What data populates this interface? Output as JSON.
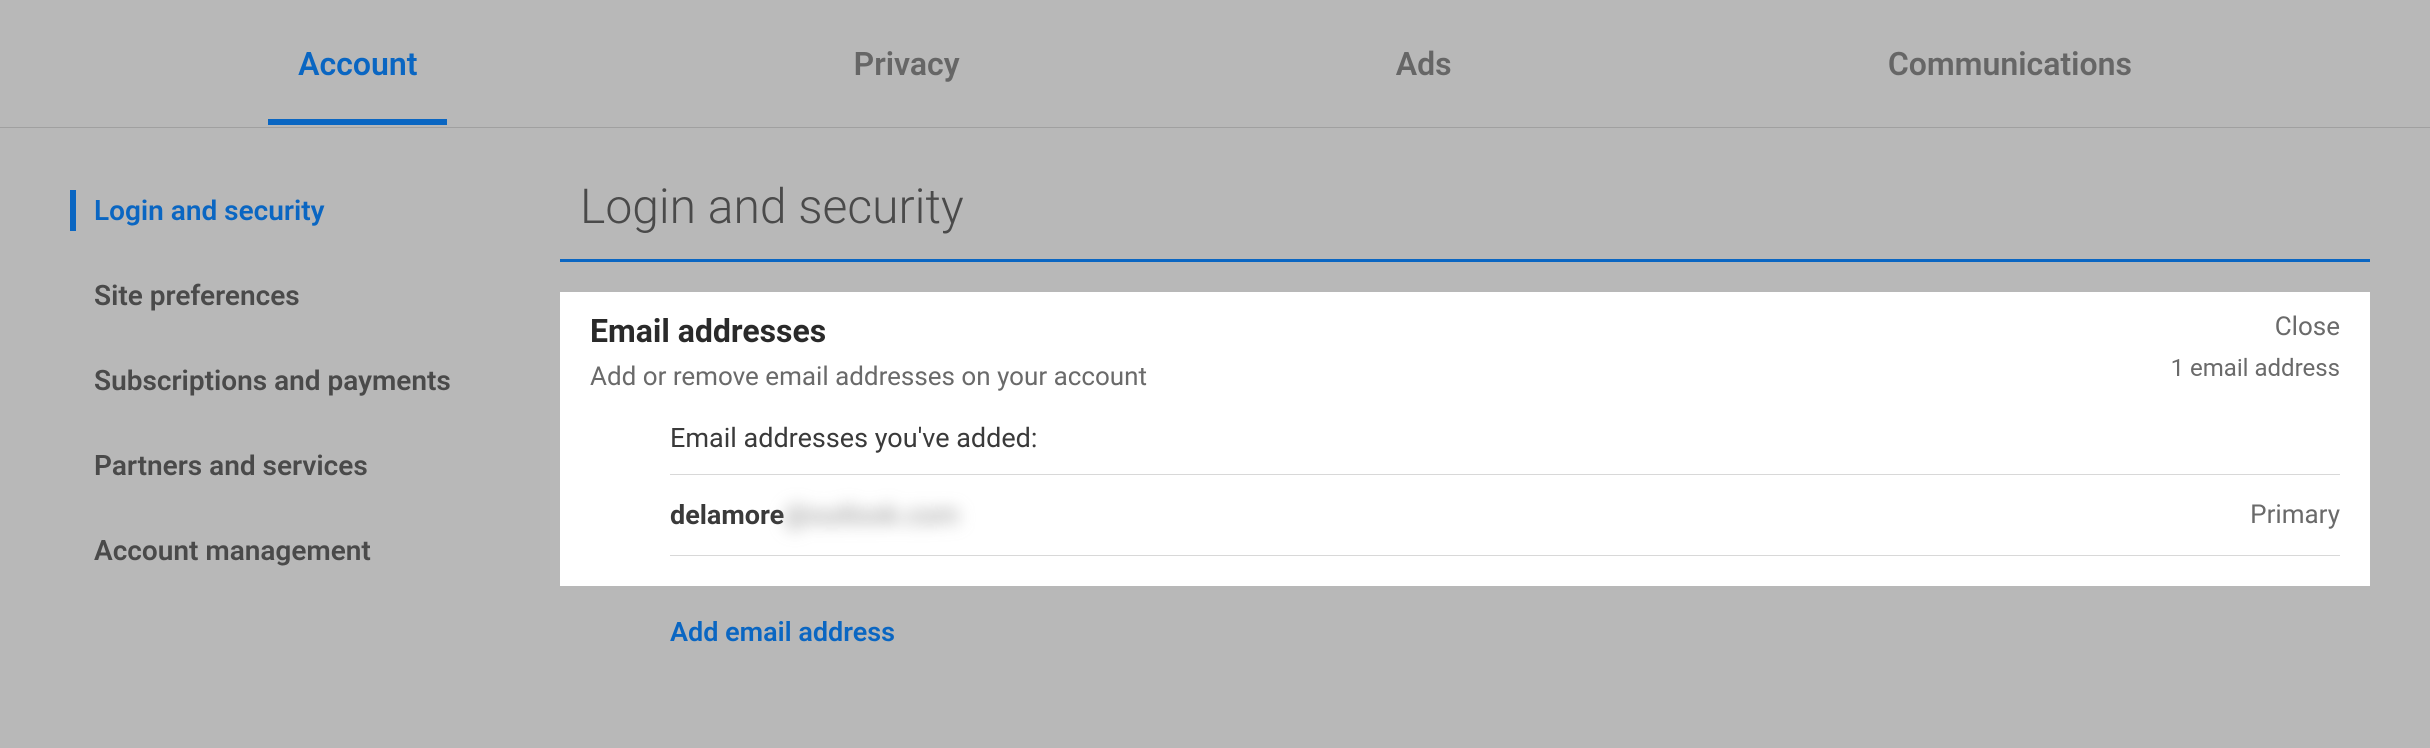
{
  "tabs": {
    "account": "Account",
    "privacy": "Privacy",
    "ads": "Ads",
    "communications": "Communications"
  },
  "sidebar": {
    "items": [
      {
        "label": "Login and security"
      },
      {
        "label": "Site preferences"
      },
      {
        "label": "Subscriptions and payments"
      },
      {
        "label": "Partners and services"
      },
      {
        "label": "Account management"
      }
    ]
  },
  "main": {
    "page_title": "Login and security",
    "panel": {
      "title": "Email addresses",
      "subtitle": "Add or remove email addresses on your account",
      "close_label": "Close",
      "count_text": "1 email address",
      "list_title": "Email addresses you've added:",
      "emails": [
        {
          "address_visible": "delamore",
          "address_hidden": "@outlook.com",
          "tag": "Primary"
        }
      ],
      "add_link": "Add email address"
    }
  }
}
